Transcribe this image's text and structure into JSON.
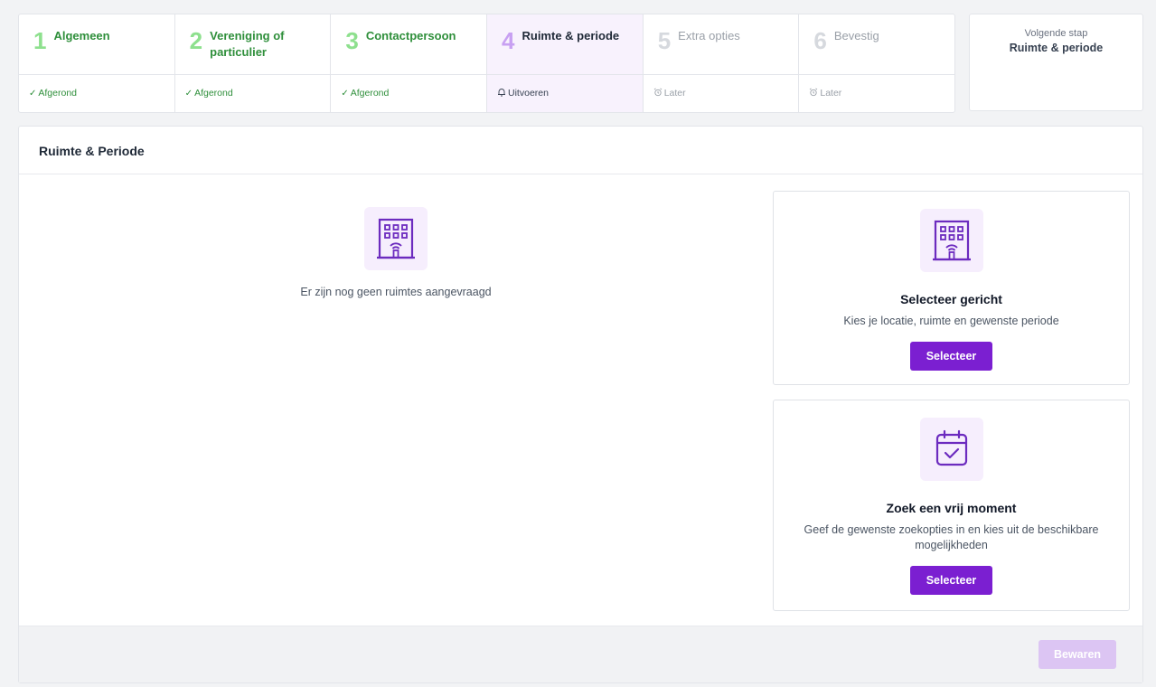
{
  "steps": [
    {
      "num": "1",
      "label": "Algemeen",
      "status": "Afgerond",
      "state": "done"
    },
    {
      "num": "2",
      "label": "Vereniging of particulier",
      "status": "Afgerond",
      "state": "done"
    },
    {
      "num": "3",
      "label": "Contactpersoon",
      "status": "Afgerond",
      "state": "done"
    },
    {
      "num": "4",
      "label": "Ruimte & periode",
      "status": "Uitvoeren",
      "state": "active"
    },
    {
      "num": "5",
      "label": "Extra opties",
      "status": "Later",
      "state": "future"
    },
    {
      "num": "6",
      "label": "Bevestig",
      "status": "Later",
      "state": "future"
    }
  ],
  "status_icons": {
    "done": "check-icon",
    "active": "bell-icon",
    "future": "alarm-clock-icon"
  },
  "next_step": {
    "caption": "Volgende stap",
    "value": "Ruimte & periode"
  },
  "panel": {
    "title": "Ruimte & Periode",
    "empty_icon": "building-icon",
    "empty_text": "Er zijn nog geen ruimtes aangevraagd",
    "save_label": "Bewaren"
  },
  "cards": [
    {
      "icon": "building-icon",
      "title": "Selecteer gericht",
      "desc": "Kies je locatie, ruimte en gewenste periode",
      "button": "Selecteer"
    },
    {
      "icon": "calendar-check-icon",
      "title": "Zoek een vrij moment",
      "desc": "Geef de gewenste zoekopties in en kies uit de beschikbare mogelijkheden",
      "button": "Selecteer"
    }
  ],
  "colors": {
    "accent": "#7b1fd1",
    "accent_light": "#f6eefd",
    "done_green": "#2f8f3b",
    "disabled_button": "#dcc5f3"
  }
}
